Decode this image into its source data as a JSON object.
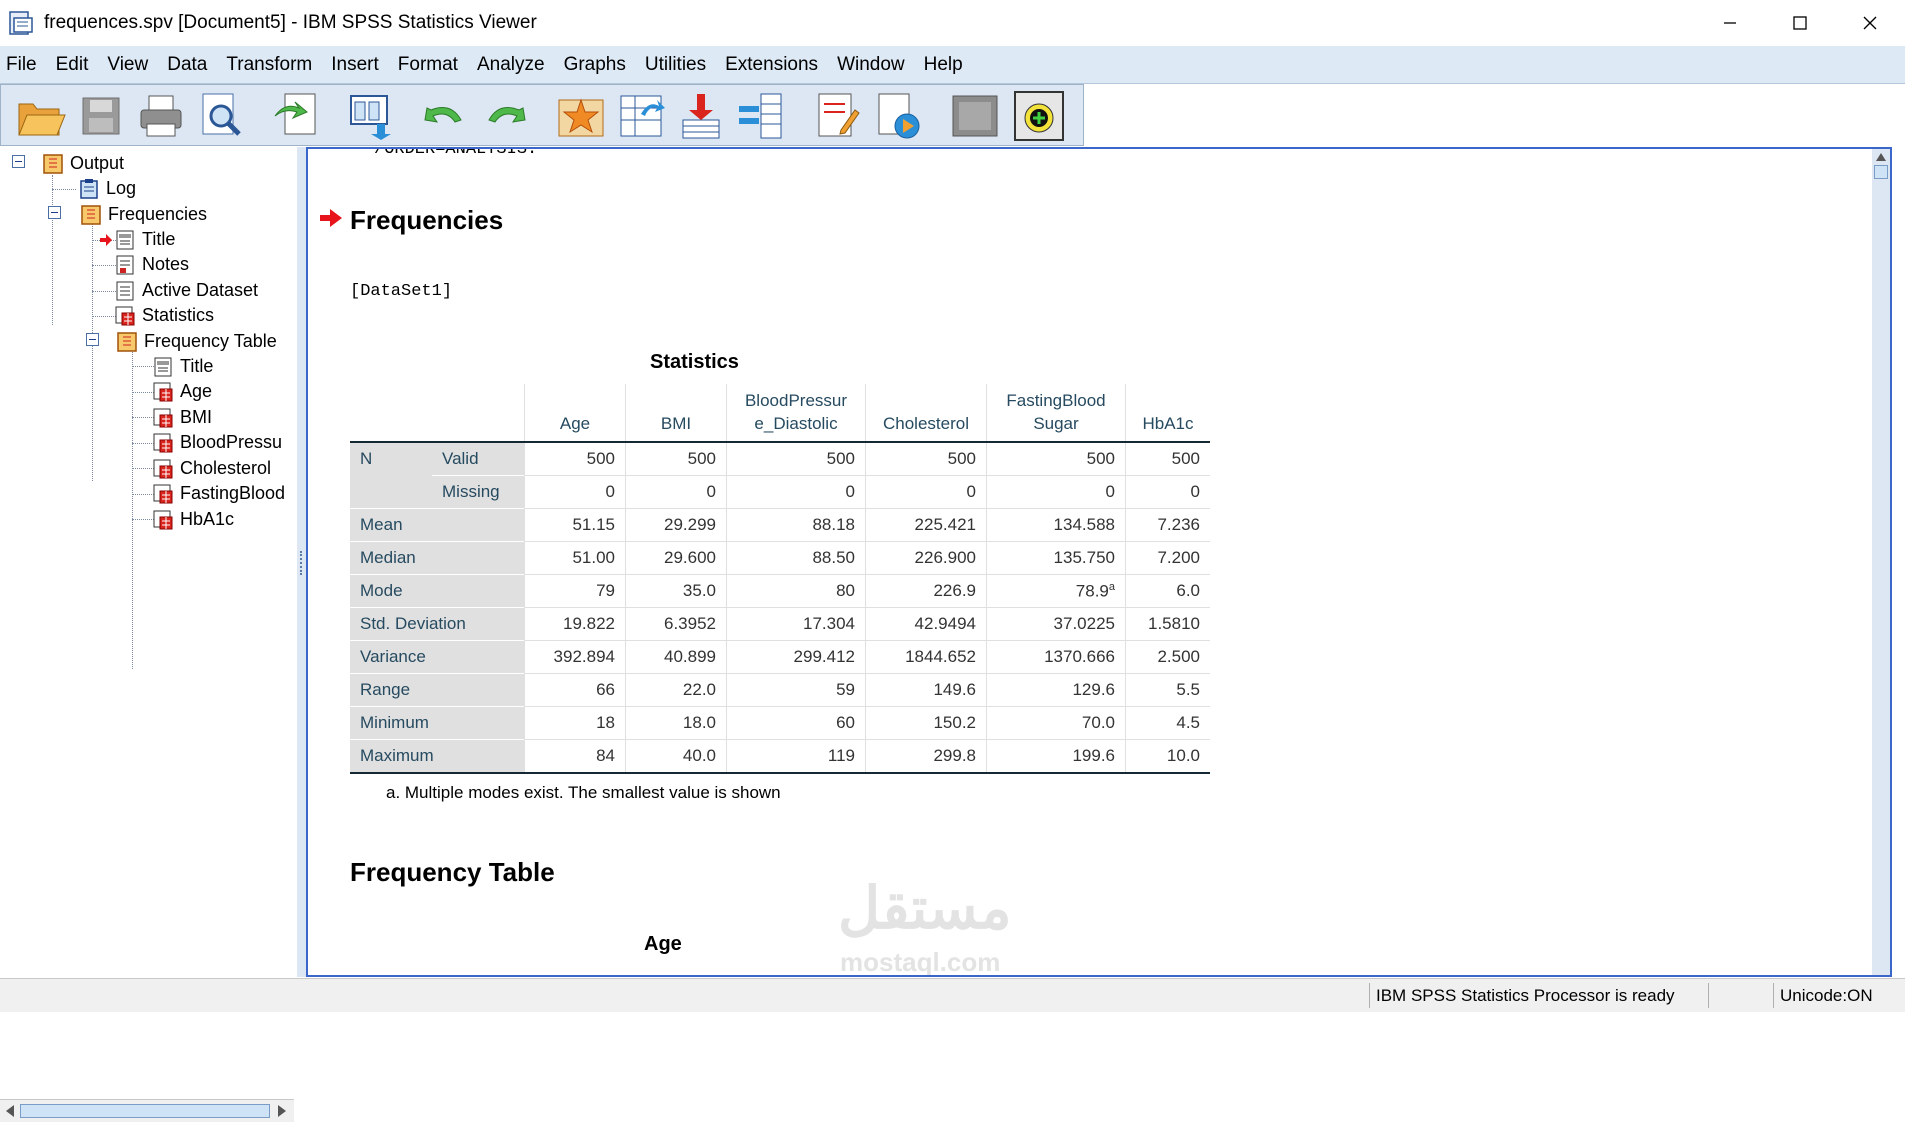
{
  "window": {
    "title": "frequences.spv [Document5] - IBM SPSS Statistics Viewer",
    "app_icon": "spss-viewer-icon",
    "buttons": [
      "minimize-icon",
      "maximize-icon",
      "close-icon"
    ]
  },
  "menu": [
    "File",
    "Edit",
    "View",
    "Data",
    "Transform",
    "Insert",
    "Format",
    "Analyze",
    "Graphs",
    "Utilities",
    "Extensions",
    "Window",
    "Help"
  ],
  "toolbar": [
    "open-icon",
    "save-icon",
    "print-icon",
    "print-preview-icon",
    "export-icon",
    "recall-dialog-icon",
    "undo-icon",
    "redo-icon",
    "goto-data-icon",
    "goto-case-icon",
    "goto-variable-icon",
    "variables-icon",
    "insert-output-icon",
    "designate-window-icon",
    "unused-icon",
    "add-icon"
  ],
  "outline": {
    "output": "Output",
    "log": "Log",
    "frequencies": "Frequencies",
    "title": "Title",
    "notes": "Notes",
    "active_dataset": "Active Dataset",
    "statistics": "Statistics",
    "frequency_table": "Frequency Table",
    "ft_title": "Title",
    "age": "Age",
    "bmi": "BMI",
    "bp": "BloodPressu",
    "chol": "Cholesterol",
    "fbs": "FastingBlood",
    "hba1c": "HbA1c"
  },
  "viewer": {
    "syntax_tail": "/ORDER=ANALYSIS.",
    "heading": "Frequencies",
    "dataset": "[DataSet1]",
    "footnote": "a. Multiple modes exist. The smallest value is shown",
    "freq_heading": "Frequency Table",
    "next_table_title": "Age",
    "watermark": "مستقل",
    "watermark_sub": "mostaql.com"
  },
  "stats_table": {
    "title": "Statistics",
    "columns": [
      "Age",
      "BMI",
      "BloodPressur e_Diastolic",
      "Cholesterol",
      "FastingBlood Sugar",
      "HbA1c"
    ],
    "rows": [
      {
        "label": "N",
        "sub": "Valid",
        "values": [
          "500",
          "500",
          "500",
          "500",
          "500",
          "500"
        ]
      },
      {
        "label": "",
        "sub": "Missing",
        "values": [
          "0",
          "0",
          "0",
          "0",
          "0",
          "0"
        ]
      },
      {
        "label": "Mean",
        "values": [
          "51.15",
          "29.299",
          "88.18",
          "225.421",
          "134.588",
          "7.236"
        ]
      },
      {
        "label": "Median",
        "values": [
          "51.00",
          "29.600",
          "88.50",
          "226.900",
          "135.750",
          "7.200"
        ]
      },
      {
        "label": "Mode",
        "values": [
          "79",
          "35.0",
          "80",
          "226.9",
          "78.9",
          "6.0"
        ],
        "superscript": "a"
      },
      {
        "label": "Std. Deviation",
        "values": [
          "19.822",
          "6.3952",
          "17.304",
          "42.9494",
          "37.0225",
          "1.5810"
        ]
      },
      {
        "label": "Variance",
        "values": [
          "392.894",
          "40.899",
          "299.412",
          "1844.652",
          "1370.666",
          "2.500"
        ]
      },
      {
        "label": "Range",
        "values": [
          "66",
          "22.0",
          "59",
          "149.6",
          "129.6",
          "5.5"
        ]
      },
      {
        "label": "Minimum",
        "values": [
          "18",
          "18.0",
          "60",
          "150.2",
          "70.0",
          "4.5"
        ]
      },
      {
        "label": "Maximum",
        "values": [
          "84",
          "40.0",
          "119",
          "299.8",
          "199.6",
          "10.0"
        ]
      }
    ]
  },
  "status": {
    "processor": "IBM SPSS Statistics Processor is ready",
    "unicode": "Unicode:ON"
  }
}
